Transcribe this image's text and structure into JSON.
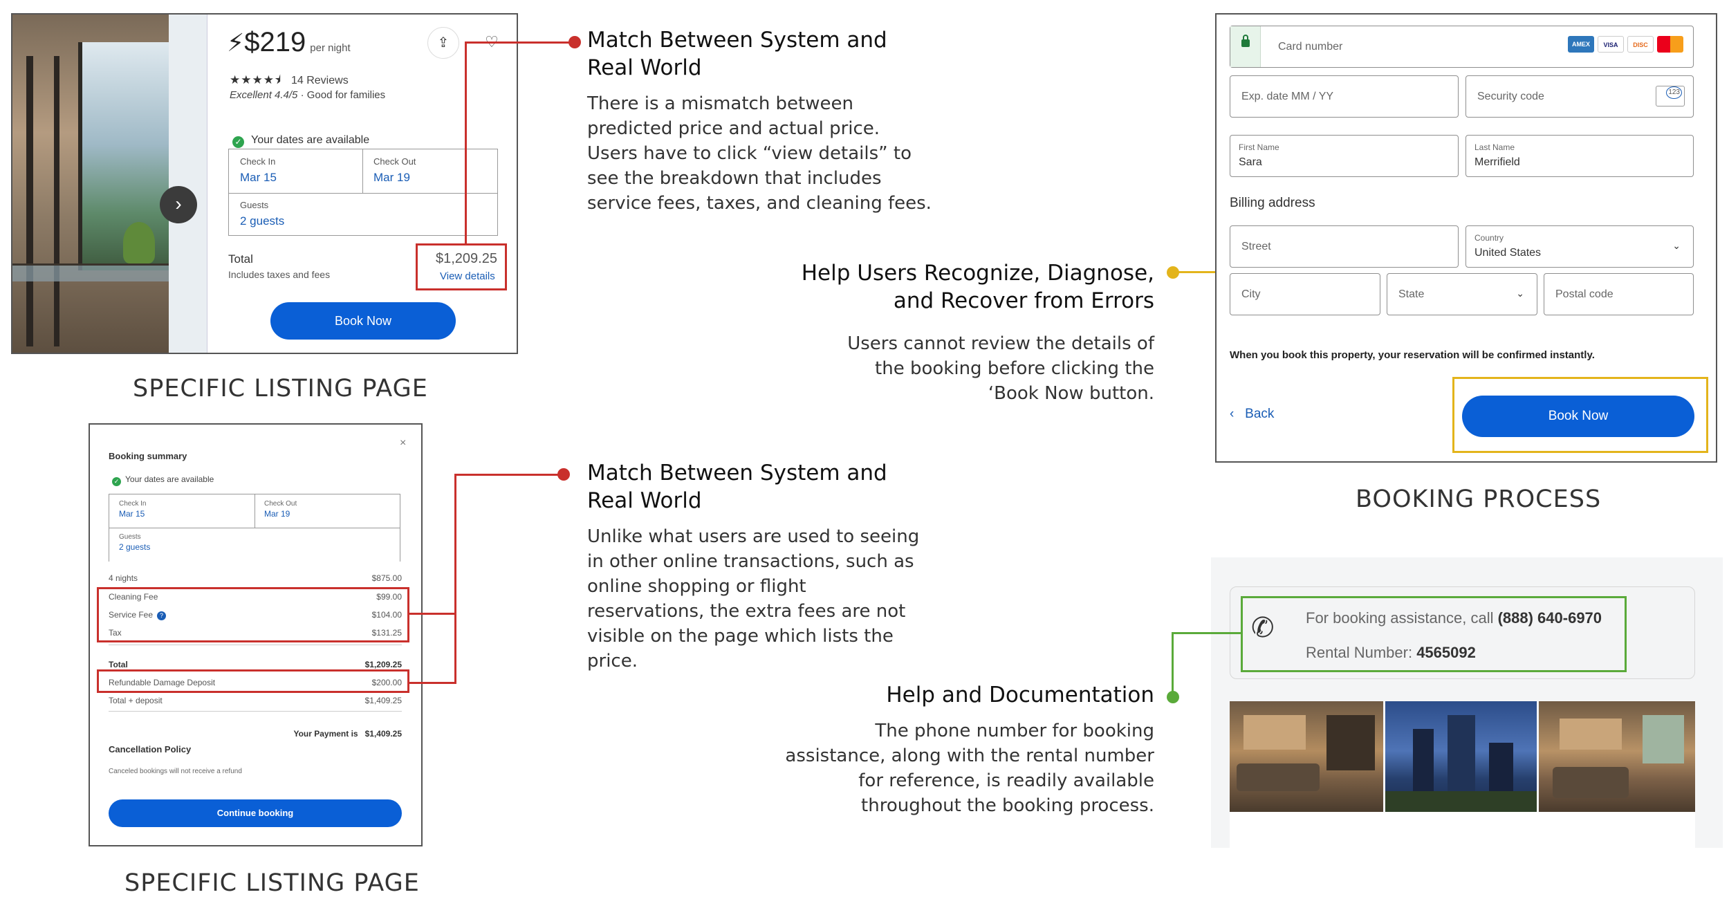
{
  "listing": {
    "price": "$219",
    "per_night": "per night",
    "stars": "★★★★⯨",
    "reviews": "14 Reviews",
    "rating": "Excellent 4.4/5",
    "rating_sep": " · ",
    "rating_tag": "Good for families",
    "share_icon": "⇪",
    "heart_icon": "♡",
    "next_icon": "›",
    "availability": "Your dates are available",
    "check_in_label": "Check In",
    "check_in_value": "Mar 15",
    "check_out_label": "Check Out",
    "check_out_value": "Mar 19",
    "guests_label": "Guests",
    "guests_value": "2 guests",
    "total_label": "Total",
    "includes": "Includes taxes and fees",
    "total_value": "$1,209.25",
    "view_details": "View details",
    "book_now": "Book Now"
  },
  "captions": {
    "listing_top": "SPECIFIC LISTING PAGE",
    "listing_bottom": "SPECIFIC LISTING PAGE",
    "booking": "BOOKING PROCESS"
  },
  "annotations": {
    "a1": {
      "title_1": "Match Between System and",
      "title_2": "Real World",
      "body": [
        "There is a mismatch between",
        "predicted price and actual price.",
        "Users have to click “view details” to",
        "see the breakdown that includes",
        "service fees, taxes, and cleaning fees."
      ]
    },
    "a2": {
      "title_1": "Help Users Recognize, Diagnose,",
      "title_2": "and Recover from Errors",
      "body": [
        "Users cannot review the details of",
        "the booking before clicking the",
        "‘Book Now button."
      ]
    },
    "a3": {
      "title_1": "Match Between System and",
      "title_2": "Real World",
      "body": [
        "Unlike what users are used to seeing",
        "in other online transactions, such as",
        "online shopping or flight",
        "reservations, the extra fees are not",
        "visible on the page which lists the",
        "price."
      ]
    },
    "a4": {
      "title": "Help and Documentation",
      "body": [
        "The phone number for booking",
        "assistance, along with the rental number",
        "for reference, is readily available",
        "throughout the booking process."
      ]
    }
  },
  "summary": {
    "title": "Booking summary",
    "close": "×",
    "availability": "Your dates are available",
    "check_in_label": "Check In",
    "check_in_value": "Mar 15",
    "check_out_label": "Check Out",
    "check_out_value": "Mar 19",
    "guests_label": "Guests",
    "guests_value": "2 guests",
    "lines": [
      {
        "label": "4 nights",
        "amount": "$875.00"
      },
      {
        "label": "Cleaning Fee",
        "amount": "$99.00"
      },
      {
        "label": "Service Fee",
        "amount": "$104.00"
      },
      {
        "label": "Tax",
        "amount": "$131.25"
      },
      {
        "label": "Total",
        "amount": "$1,209.25"
      },
      {
        "label": "Refundable Damage Deposit",
        "amount": "$200.00"
      },
      {
        "label": "Total + deposit",
        "amount": "$1,409.25"
      }
    ],
    "payment_label": "Your Payment is",
    "payment_value": "$1,409.25",
    "cancel_title": "Cancellation Policy",
    "cancel_text": "Canceled bookings will not receive a refund",
    "continue": "Continue booking"
  },
  "form": {
    "card_number": "Card number",
    "card_brands": [
      "AMEX",
      "VISA",
      "DISC",
      "MC"
    ],
    "exp_date": "Exp. date MM / YY",
    "security_code": "Security code",
    "cvv_badge": "123",
    "first_name_label": "First Name",
    "first_name_value": "Sara",
    "last_name_label": "Last Name",
    "last_name_value": "Merrifield",
    "billing_title": "Billing address",
    "street": "Street",
    "country_label": "Country",
    "country_value": "United States",
    "city": "City",
    "state": "State",
    "postal": "Postal code",
    "confirm_text": "When you book this property, your reservation will be confirmed instantly.",
    "back": "Back",
    "book_now": "Book Now"
  },
  "help": {
    "assist_prefix": "For booking assistance, call ",
    "assist_phone": "(888) 640-6970",
    "rental_prefix": "Rental Number: ",
    "rental_number": "4565092",
    "phone_icon": "✆"
  },
  "colors": {
    "accent_blue": "#0a5fd6",
    "highlight_red": "#c9302c",
    "highlight_yellow": "#e3b41b",
    "highlight_green": "#5aaa3a"
  }
}
